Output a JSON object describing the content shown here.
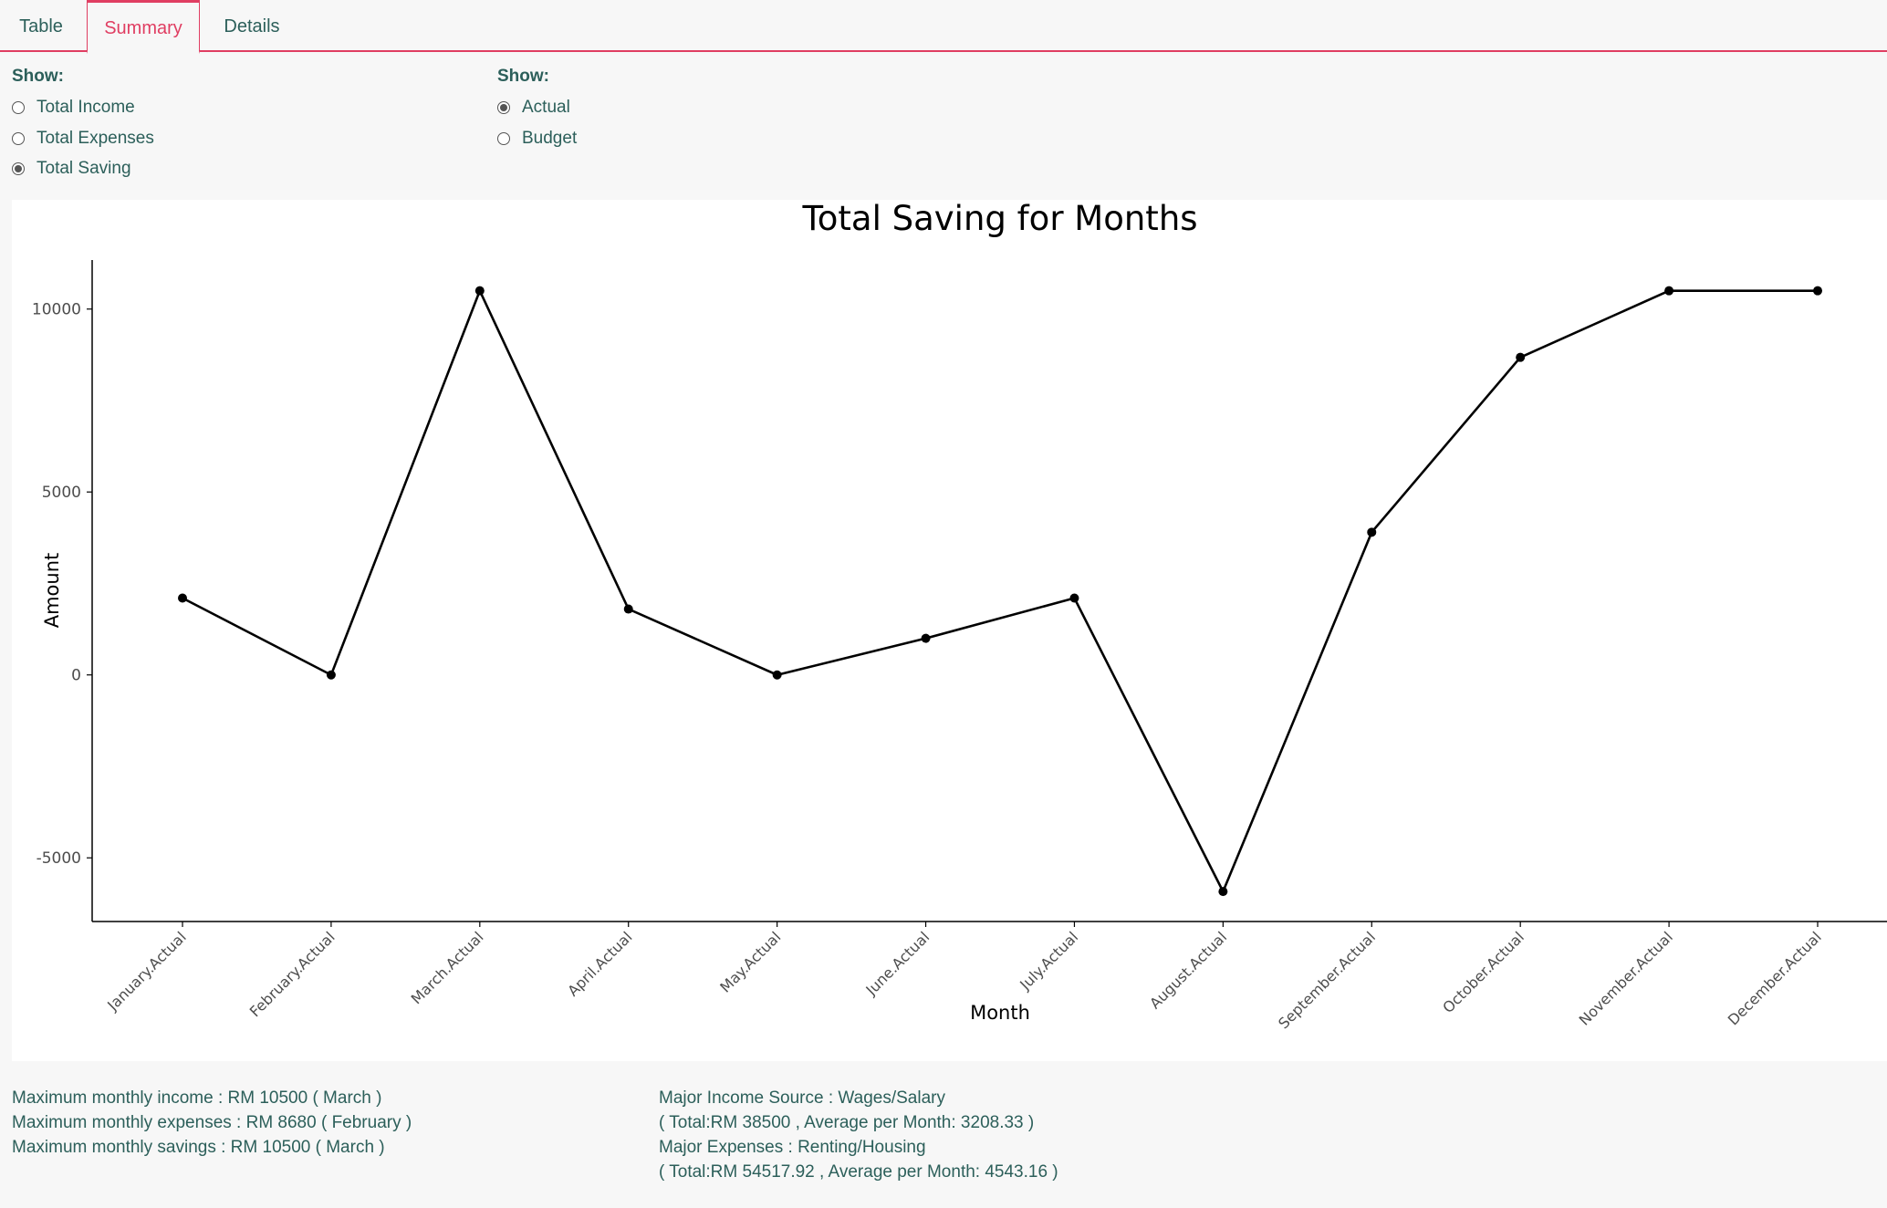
{
  "tabs": [
    {
      "label": "Table",
      "active": false
    },
    {
      "label": "Summary",
      "active": true
    },
    {
      "label": "Details",
      "active": false
    }
  ],
  "show_measure": {
    "label": "Show:",
    "options": [
      {
        "label": "Total Income",
        "checked": false
      },
      {
        "label": "Total Expenses",
        "checked": false
      },
      {
        "label": "Total Saving",
        "checked": true
      }
    ]
  },
  "show_type": {
    "label": "Show:",
    "options": [
      {
        "label": "Actual",
        "checked": true
      },
      {
        "label": "Budget",
        "checked": false
      }
    ]
  },
  "chart_data": {
    "type": "line",
    "title": "Total Saving for Months",
    "xlabel": "Month",
    "ylabel": "Amount",
    "categories": [
      "January.Actual",
      "February.Actual",
      "March.Actual",
      "April.Actual",
      "May.Actual",
      "June.Actual",
      "July.Actual",
      "August.Actual",
      "September.Actual",
      "October.Actual",
      "November.Actual",
      "December.Actual"
    ],
    "values": [
      2100,
      0,
      10500,
      1800,
      0,
      1000,
      2100,
      -5920,
      3900,
      8680,
      10500,
      10500
    ],
    "yticks": [
      -5000,
      0,
      5000,
      10000
    ],
    "ylim": [
      -6740,
      11340
    ],
    "grid": false,
    "line_color": "#000000"
  },
  "summary_left": [
    "Maximum monthly income : RM 10500 ( March )",
    "Maximum monthly expenses : RM 8680 ( February )",
    "Maximum monthly savings : RM 10500 ( March )"
  ],
  "summary_right": [
    "Major Income Source : Wages/Salary",
    "( Total:RM 38500 , Average per Month: 3208.33 )",
    "Major Expenses : Renting/Housing",
    "( Total:RM 54517.92 , Average per Month: 4543.16 )"
  ],
  "colors": {
    "accent": "#e03e62",
    "text": "#2c5f5a",
    "background": "#f7f7f7"
  }
}
